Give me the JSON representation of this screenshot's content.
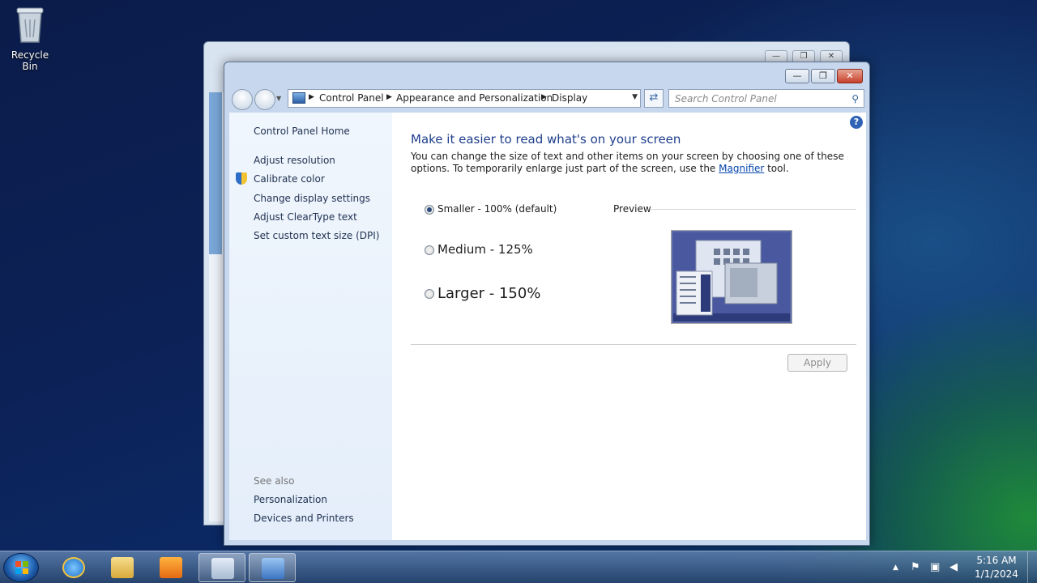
{
  "desktop": {
    "recycle_bin_label": "Recycle Bin",
    "icon": "recycle-bin-icon"
  },
  "window": {
    "controls": {
      "minimize": "—",
      "maximize": "❐",
      "close": "✕"
    },
    "breadcrumb": [
      "Control Panel",
      "Appearance and Personalization",
      "Display"
    ],
    "search_placeholder": "Search Control Panel",
    "accent": "#1e3e8c"
  },
  "sidebar": {
    "home": "Control Panel Home",
    "items": [
      "Adjust resolution",
      "Calibrate color",
      "Change display settings",
      "Adjust ClearType text",
      "Set custom text size (DPI)"
    ],
    "see_also_label": "See also",
    "see_also": [
      "Personalization",
      "Devices and Printers"
    ]
  },
  "main": {
    "heading": "Make it easier to read what's on your screen",
    "desc_part1": "You can change the size of text and other items on your screen by choosing one of these options. To temporarily enlarge just part of the screen, use the ",
    "desc_link": "Magnifier",
    "desc_part2": " tool.",
    "options": [
      {
        "label": "Smaller - 100% (default)",
        "selected": true
      },
      {
        "label": "Medium - 125%",
        "selected": false
      },
      {
        "label": "Larger - 150%",
        "selected": false
      }
    ],
    "preview_label": "Preview",
    "apply_label": "Apply"
  },
  "taskbar": {
    "items": [
      "start-orb",
      "internet-explorer",
      "windows-explorer",
      "media-player",
      "notepad",
      "control-panel"
    ],
    "clock_time": "5:16 AM",
    "clock_date": "1/1/2024"
  }
}
